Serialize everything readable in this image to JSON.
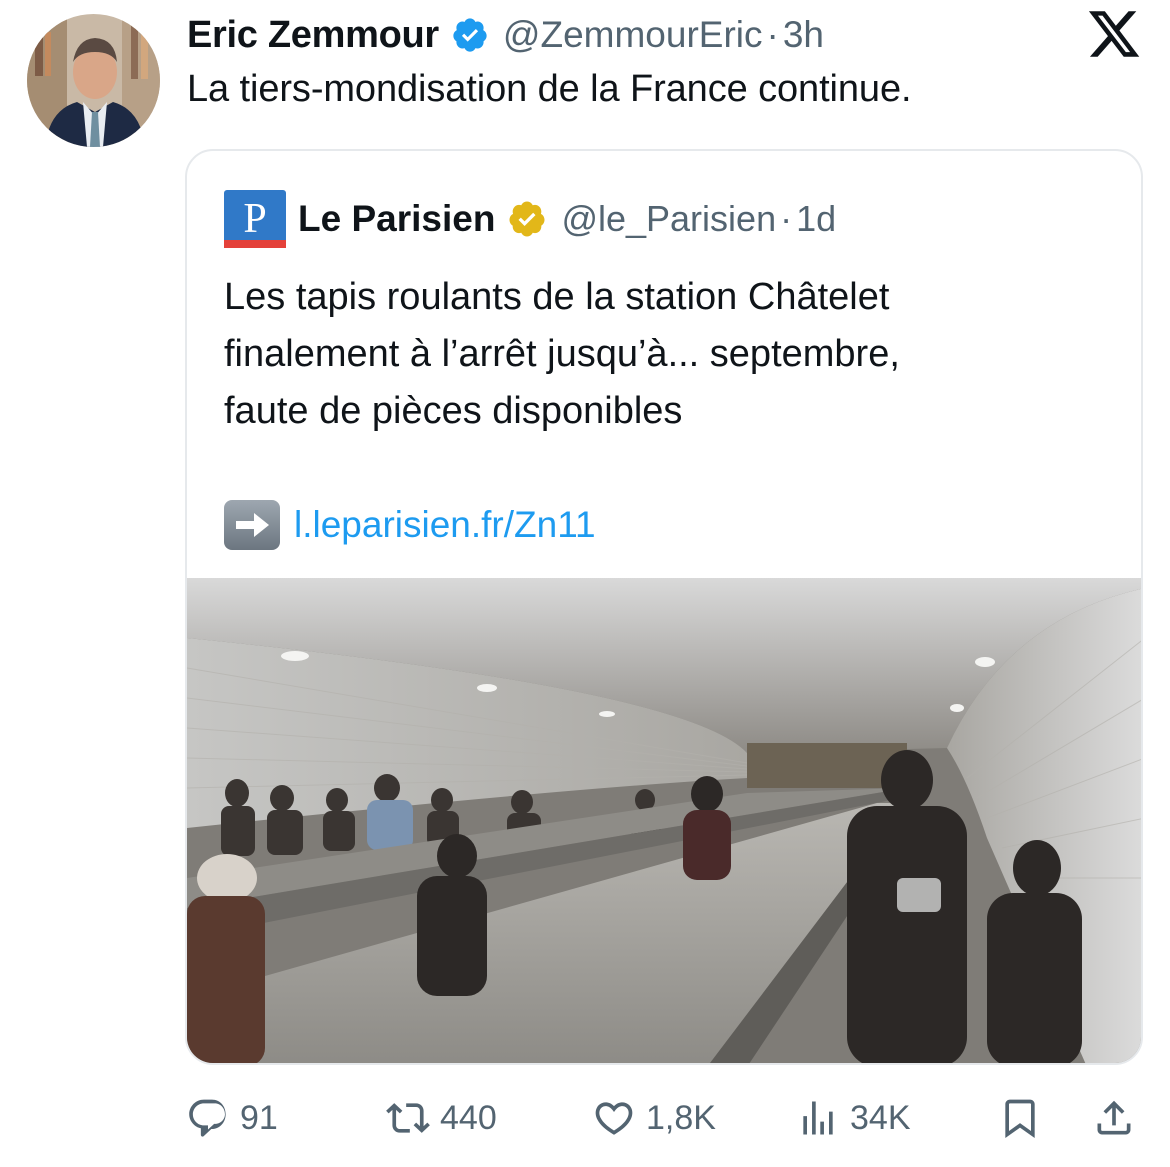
{
  "tweet": {
    "author_name": "Eric Zemmour",
    "handle": "@ZemmourEric",
    "separator": "·",
    "time": "3h",
    "text": "La tiers-mondisation de la France continue.",
    "avatar_icon": "profile-photo",
    "verified_icon": "verified-badge-icon",
    "verified_color": "#1d9bf0",
    "platform_icon": "x-logo-icon"
  },
  "quote": {
    "author_name": "Le Parisien",
    "handle": "@le_Parisien",
    "separator": "·",
    "time": "1d",
    "logo_letter": "P",
    "logo_color": "#3079c8",
    "badge_icon": "gold-verified-badge-icon",
    "badge_color": "#e2b719",
    "text_lines": [
      "Les tapis roulants de la station Châtelet",
      "finalement à l’arrêt jusqu’à... septembre,",
      "faute de pièces disponibles"
    ],
    "link_emoji": "➡️",
    "link": "l.leparisien.fr/Zn11",
    "link_color": "#1d9bf0",
    "media_icon": "metro-travelator-photo"
  },
  "actions": {
    "replies": "91",
    "reposts": "440",
    "likes": "1,8K",
    "views": "34K",
    "icons": [
      "reply-icon",
      "repost-icon",
      "like-icon",
      "views-icon",
      "bookmark-icon",
      "share-icon"
    ],
    "icon_color": "#536471"
  }
}
